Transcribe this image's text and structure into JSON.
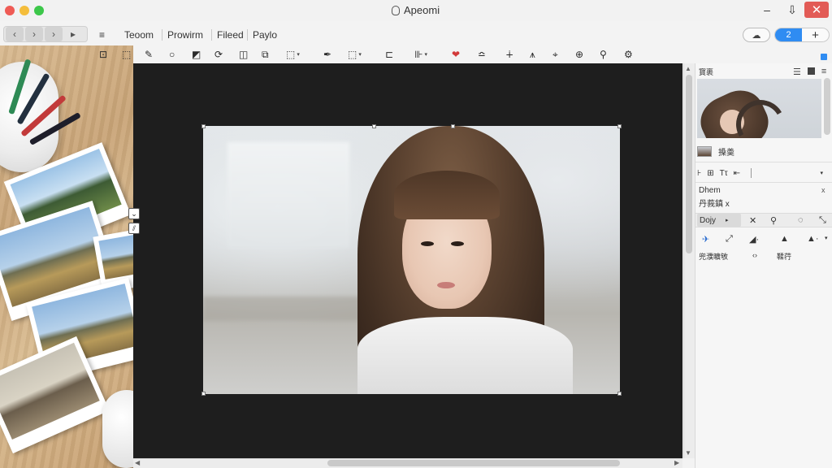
{
  "window": {
    "title": "Apeomi",
    "minimize_glyph": "–",
    "restore_glyph": "⇩",
    "close_glyph": "✕"
  },
  "nav": {
    "back_glyph": "‹",
    "forward_glyph": "›",
    "next_glyph": "›",
    "more_glyph": "▸"
  },
  "menu": {
    "icon_glyph": "≡",
    "items": [
      "Teoom",
      "Prowirm",
      "Fileed",
      "Paylo"
    ]
  },
  "header_right": {
    "cloud_glyph": "☁",
    "pill_left": "2",
    "pill_right": "+"
  },
  "tools": {
    "icons": [
      "select-add-icon",
      "rect-select-icon",
      "brush-icon",
      "ellipse-icon",
      "gradient-icon",
      "lasso-icon",
      "crop-icon",
      "clone-icon",
      "transform-icon",
      "eyedropper-icon",
      "shape-icon",
      "align-icon",
      "distribute-icon",
      "heal-icon",
      "baseline-icon",
      "plus-line-icon",
      "pen-icon",
      "fill-icon",
      "target-icon",
      "puppet-icon",
      "gear-icon"
    ],
    "glyphs": [
      "⊡",
      "⬚",
      "✎",
      "○",
      "◩",
      "⟳",
      "◫",
      "⧉",
      "⬚",
      "✒",
      "⬚",
      "⊏",
      "⊪",
      "❤",
      "≏",
      "∔",
      "⩚",
      "⌖",
      "⊕",
      "⚲",
      "⚙"
    ],
    "caret_glyph": "▾"
  },
  "canvas": {
    "side_handles": [
      "⌄",
      "⫽"
    ]
  },
  "scroll": {
    "up": "▲",
    "down": "▼",
    "left": "◀",
    "right": "▶"
  },
  "panel": {
    "header_label": "寳裹",
    "header_icons": [
      "☰",
      "■",
      "≡"
    ],
    "layer_name": "搡羮",
    "text_tools": [
      "⊦",
      "⊞",
      "Tτ",
      "⇤"
    ],
    "drop_glyph": "▾",
    "props_title": "Dhem",
    "props_close": "x",
    "props_sub": "丹莪鎮 x",
    "tab_label": "Dojy",
    "tab_caret": "▸",
    "tab_icons": [
      "✕",
      "⚲",
      "◌",
      "⤡"
    ],
    "row_tools": [
      "✈",
      "⤢",
      "◢·",
      "▲",
      "▲·"
    ],
    "row_drop": "▾",
    "labels": [
      "兜濮曠敂",
      "‹›",
      "鞣荇"
    ]
  },
  "colors": {
    "accent": "#2f8cf2",
    "close_red": "#e25b56",
    "canvas_bg": "#1e1e1e"
  }
}
